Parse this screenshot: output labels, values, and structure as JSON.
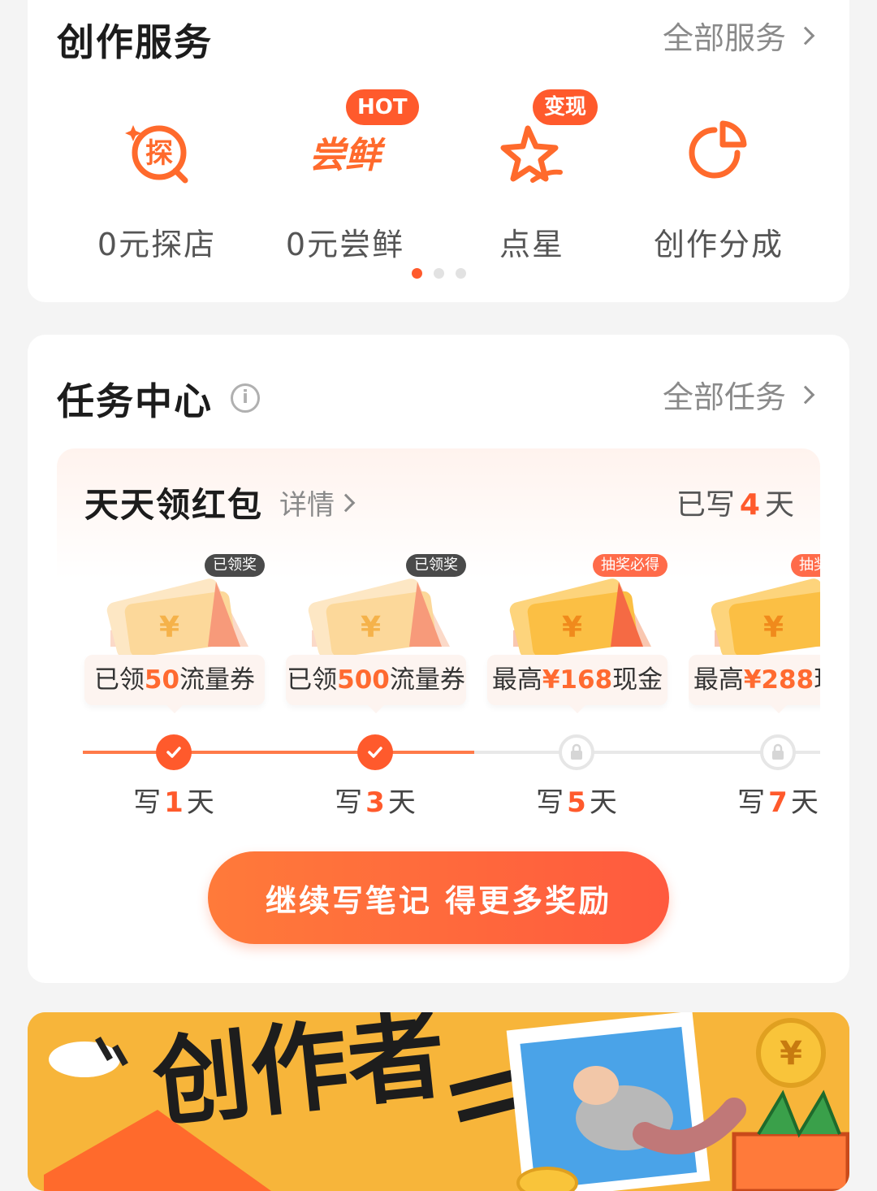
{
  "services": {
    "title": "创作服务",
    "more": "全部服务",
    "items": [
      {
        "label": "0元探店",
        "icon": "explore-shop-icon",
        "badge": ""
      },
      {
        "label": "0元尝鲜",
        "icon": "try-new-icon",
        "badge": "HOT"
      },
      {
        "label": "点星",
        "icon": "star-point-icon",
        "badge": "变现"
      },
      {
        "label": "创作分成",
        "icon": "pie-chart-icon",
        "badge": ""
      }
    ],
    "page_index": 1,
    "page_count": 3
  },
  "tasks": {
    "title": "任务中心",
    "more": "全部任务",
    "red_packet": {
      "title": "天天领红包",
      "detail": "详情",
      "days_prefix": "已写",
      "days_count": "4",
      "days_suffix": "天"
    },
    "rewards": [
      {
        "tag": "已领奖",
        "pre": "已领",
        "hl": "50",
        "post": "流量券",
        "state": "done"
      },
      {
        "tag": "已领奖",
        "pre": "已领",
        "hl": "500",
        "post": "流量券",
        "state": "done"
      },
      {
        "tag": "抽奖必得",
        "pre": "最高",
        "hl": "¥168",
        "post": "现金",
        "state": "locked"
      },
      {
        "tag": "抽奖",
        "pre": "最高",
        "hl": "¥288",
        "post": "现金",
        "state": "locked"
      }
    ],
    "milestones": [
      {
        "pre": "写",
        "n": "1",
        "post": "天"
      },
      {
        "pre": "写",
        "n": "3",
        "post": "天"
      },
      {
        "pre": "写",
        "n": "5",
        "post": "天"
      },
      {
        "pre": "写",
        "n": "7",
        "post": "天"
      }
    ],
    "cta": "继续写笔记 得更多奖励"
  },
  "banner": {
    "headline": "创作者"
  },
  "colors": {
    "accent": "#ff5a2c",
    "banner_bg": "#f7b53a"
  }
}
